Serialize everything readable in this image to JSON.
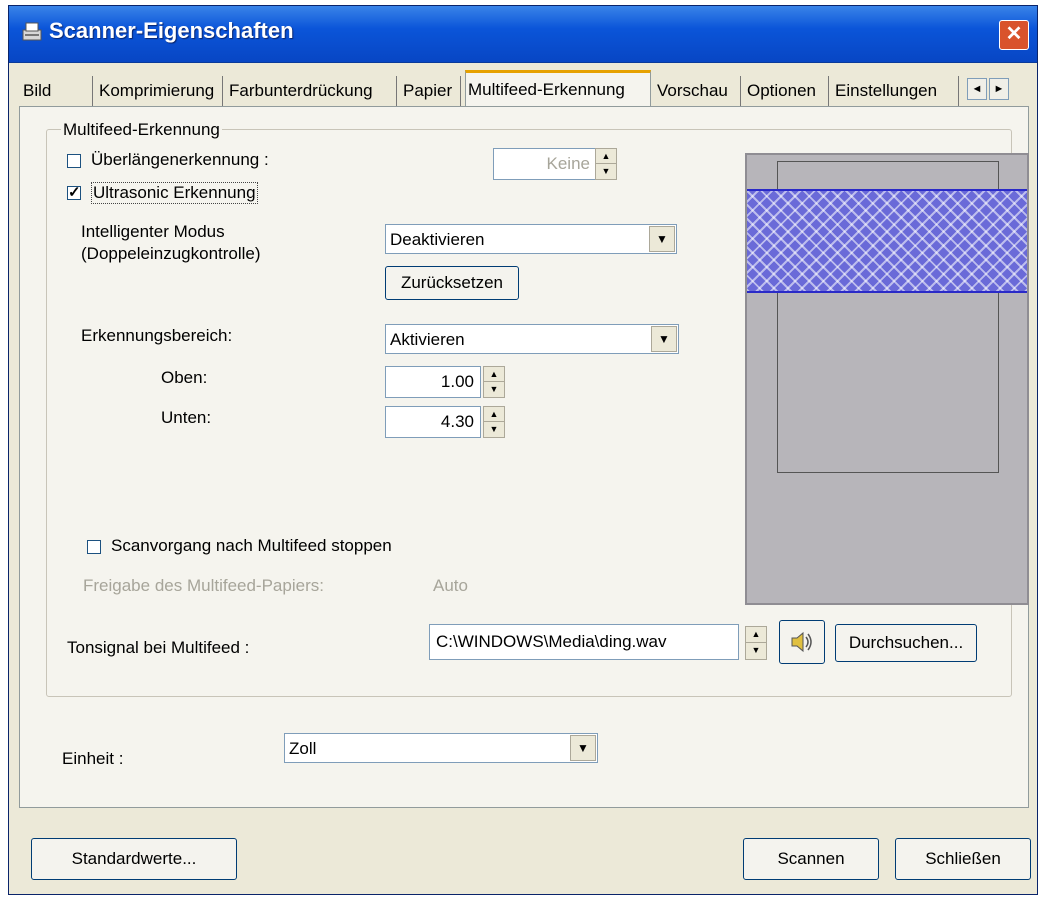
{
  "window": {
    "title": "Scanner-Eigenschaften",
    "close_glyph": "✕"
  },
  "tabs": [
    {
      "label": "Bild"
    },
    {
      "label": "Komprimierung"
    },
    {
      "label": "Farbunterdrückung"
    },
    {
      "label": "Papier"
    },
    {
      "label": "Multifeed-Erkennung"
    },
    {
      "label": "Vorschau"
    },
    {
      "label": "Optionen"
    },
    {
      "label": "Einstellungen"
    }
  ],
  "tab_scroll": {
    "left_glyph": "◄",
    "right_glyph": "►"
  },
  "group": {
    "title": "Multifeed-Erkennung",
    "length_check": {
      "label": "Überlängenerkennung :",
      "checked": false,
      "value": "Keine"
    },
    "ultrasonic": {
      "label": "Ultrasonic Erkennung",
      "checked": true,
      "check_glyph": "✓"
    },
    "smart_mode": {
      "label_line1": "Intelligenter Modus",
      "label_line2": "(Doppeleinzugkontrolle)",
      "value": "Deaktivieren"
    },
    "reset_button": "Zurücksetzen",
    "detection_area": {
      "label": "Erkennungsbereich:",
      "value": "Aktivieren"
    },
    "top": {
      "label": "Oben:",
      "value": "1.00"
    },
    "bottom": {
      "label": "Unten:",
      "value": "4.30"
    },
    "stop_scan": {
      "label": "Scanvorgang nach Multifeed stoppen",
      "checked": false
    },
    "release": {
      "label": "Freigabe des Multifeed-Papiers:",
      "value": "Auto"
    },
    "tone": {
      "label": "Tonsignal bei Multifeed :",
      "path": "C:\\WINDOWS\\Media\\ding.wav",
      "browse_button": "Durchsuchen..."
    }
  },
  "unit": {
    "label": "Einheit :",
    "value": "Zoll"
  },
  "footer": {
    "defaults_button": "Standardwerte...",
    "scan_button": "Scannen",
    "close_button": "Schließen"
  },
  "icons": {
    "speaker": "speaker-icon",
    "dropdown": "chevron-down-icon"
  },
  "colors": {
    "titlebar": "#0b55d9",
    "detection_band": "#6a6ad8",
    "active_tab_accent": "#e6a100"
  }
}
